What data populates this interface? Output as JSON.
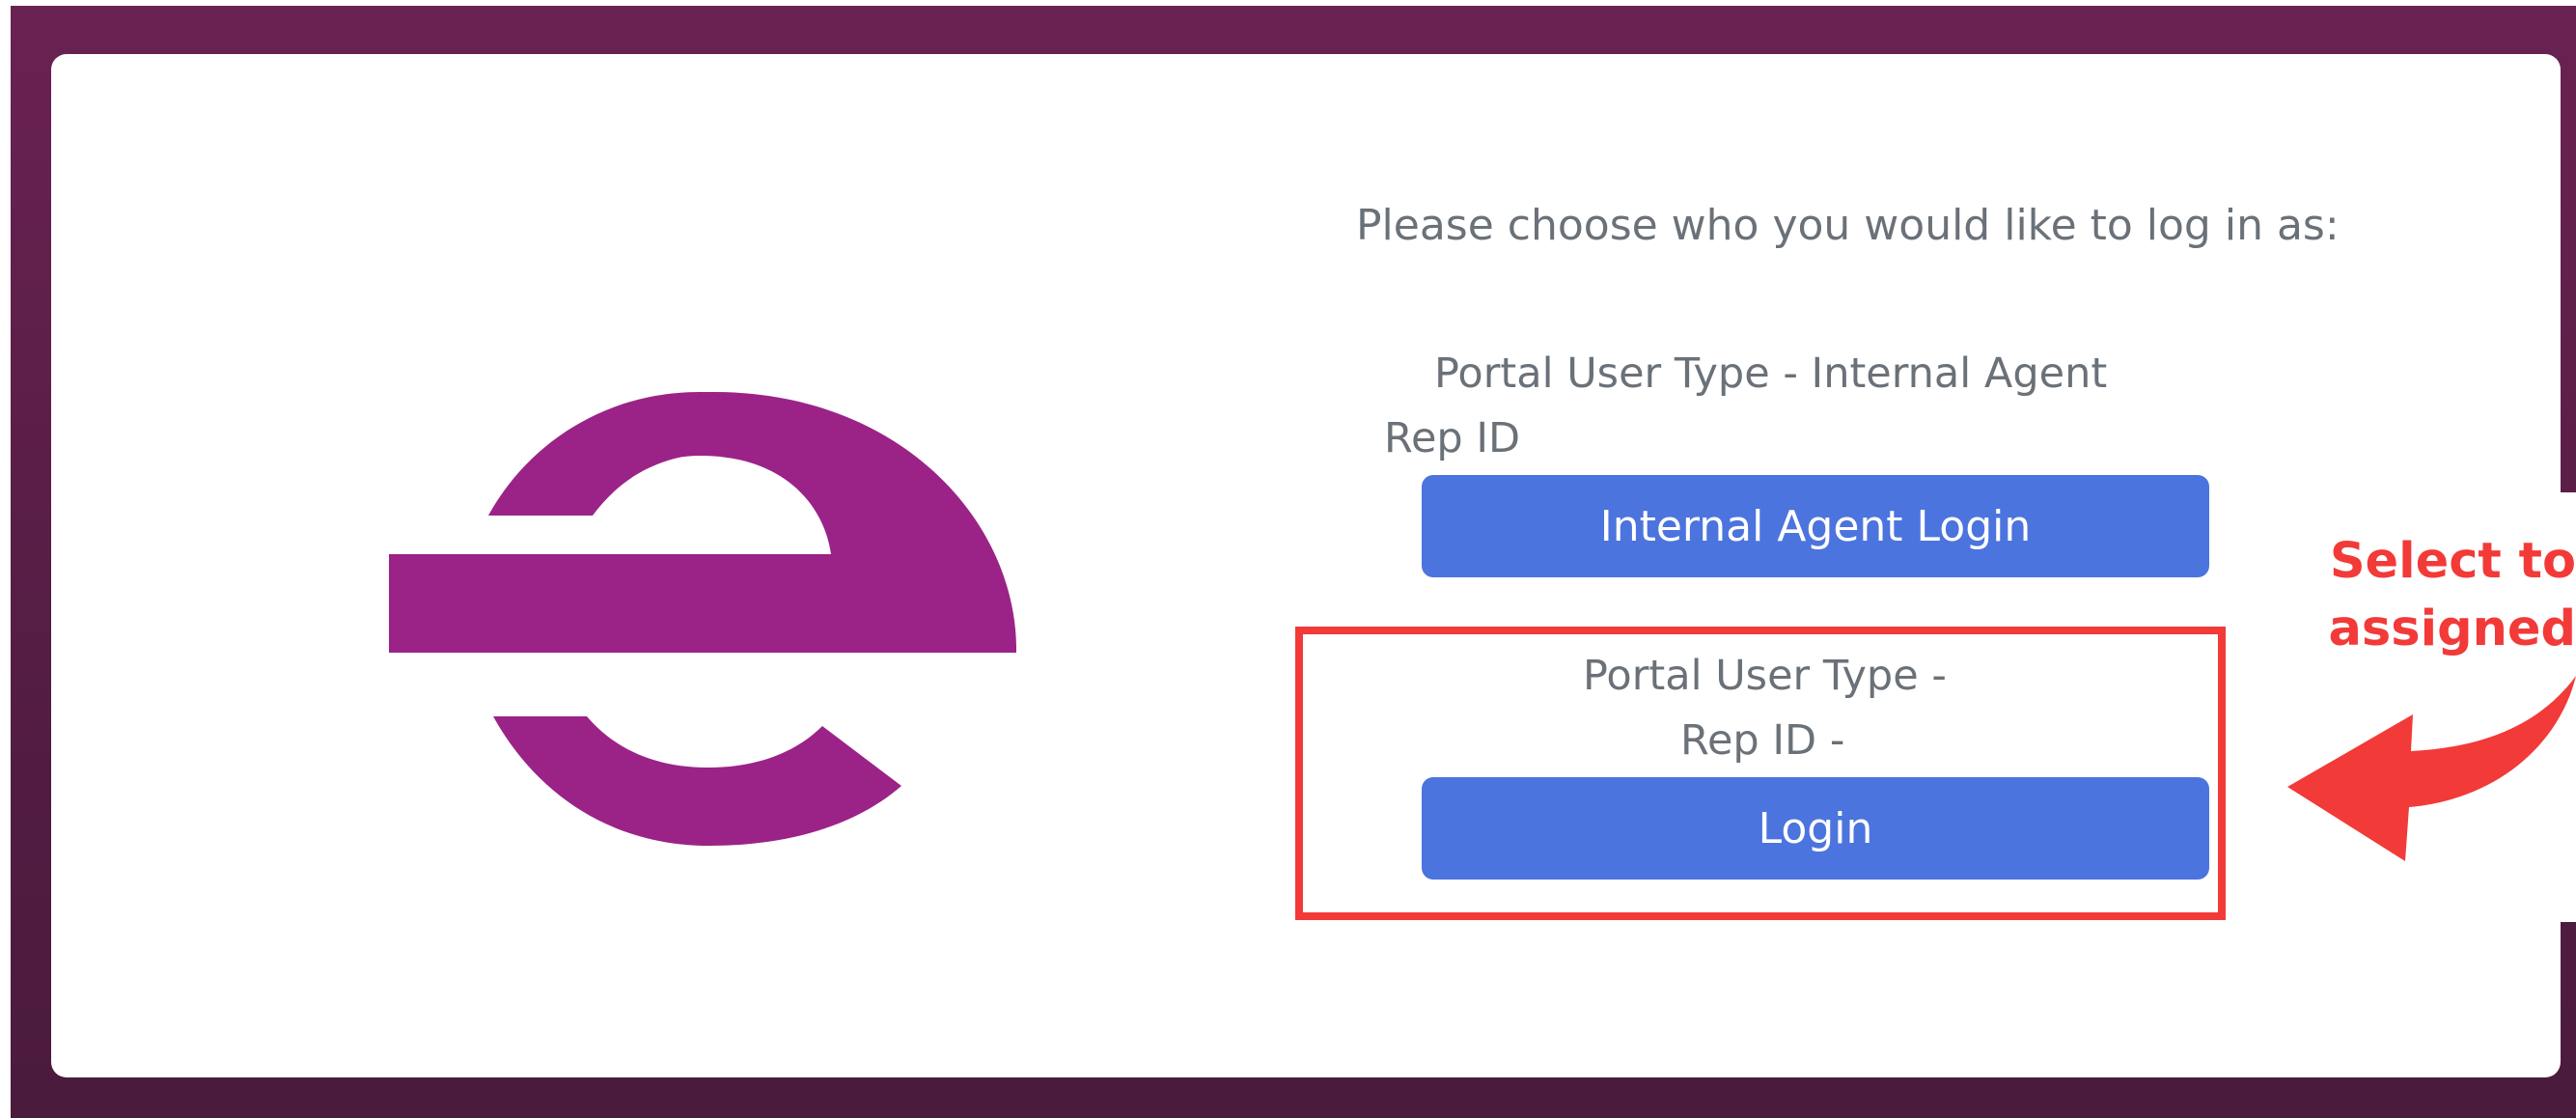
{
  "colors": {
    "background": "#5a1e48",
    "card": "#ffffff",
    "logo": "#9b2387",
    "button": "#4c74de",
    "button_text": "#ffffff",
    "label_text": "#6a7178",
    "annotation_red": "#f23a38"
  },
  "prompt": "Please choose who you would like to log in as:",
  "internal_agent": {
    "portal_user_type": "Portal User Type - Internal Agent",
    "rep_id": "Rep ID",
    "button_label": "Internal Agent Login"
  },
  "standard_user": {
    "portal_user_type": "Portal User Type -",
    "rep_id": "Rep ID -",
    "button_label": "Login"
  },
  "annotation": {
    "line1": "Select to",
    "line2": "assigned"
  },
  "icons": {
    "logo": "brand-e-logo",
    "arrow": "curved-arrow-left-icon"
  }
}
